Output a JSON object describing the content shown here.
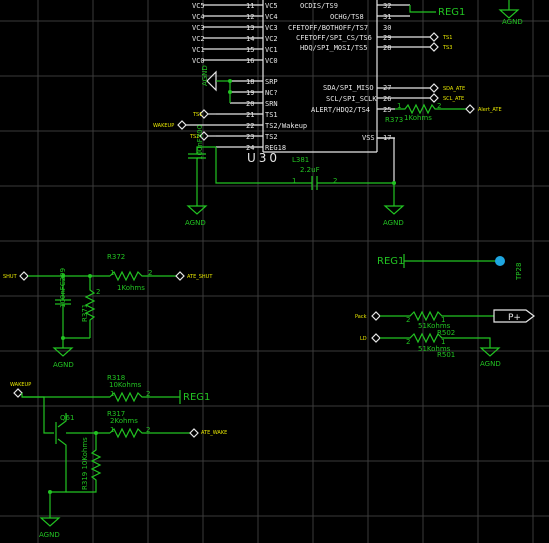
{
  "ic": {
    "refdes": "U30",
    "left": [
      {
        "net": "VC5",
        "num": "11",
        "pin": "VC5"
      },
      {
        "net": "VC4",
        "num": "12",
        "pin": "VC4"
      },
      {
        "net": "VC3",
        "num": "13",
        "pin": "VC3"
      },
      {
        "net": "VC2",
        "num": "14",
        "pin": "VC2"
      },
      {
        "net": "VC1",
        "num": "15",
        "pin": "VC1"
      },
      {
        "net": "VC0",
        "num": "16",
        "pin": "VC0"
      },
      {
        "num": "18",
        "pin": "SRP"
      },
      {
        "num": "19",
        "pin": "NC?"
      },
      {
        "num": "20",
        "pin": "SRN"
      },
      {
        "num": "21",
        "pin": "TS1"
      },
      {
        "num": "22",
        "pin": "TS2/Wakeup"
      },
      {
        "num": "23",
        "pin": "TS2"
      },
      {
        "num": "24",
        "pin": "REG18"
      }
    ],
    "right": [
      {
        "num": "32",
        "pin": "OCDIS/TS9"
      },
      {
        "num": "31",
        "pin": "OCHG/TS8"
      },
      {
        "num": "30",
        "pin": "CFETOFF/BOTHOFF/TS7"
      },
      {
        "num": "29",
        "pin": "CFETOFF/SPI_CS/TS6"
      },
      {
        "num": "28",
        "pin": "HDQ/SPI_MOSI/TS5"
      },
      {
        "num": "27",
        "pin": "SDA/SPI_MISO"
      },
      {
        "num": "26",
        "pin": "SCL/SPI_SCLK"
      },
      {
        "num": "25",
        "pin": "ALERT/HDQ2/TS4"
      },
      {
        "num": "17",
        "pin": "VSS"
      }
    ]
  },
  "nets": {
    "reg1": "REG1",
    "agnd": "AGND"
  },
  "ports": {
    "ts1": "TS1",
    "ts2": "TS2",
    "ts3": "TS3",
    "sda": "SDA_ATE",
    "scl": "SCL_ATE",
    "alert": "Alert_ATE",
    "wakeup": "WAKEUP",
    "shut": "SHUT",
    "ate_shut": "ATE_SHUT",
    "ate_wake": "ATE_WAKE",
    "pack": "Pack",
    "ld": "LD",
    "p_plus": "P+"
  },
  "components": {
    "r373": {
      "ref": "R373",
      "value": "1Kohms",
      "pin1": "1",
      "pin2": "2"
    },
    "c300": {
      "label": "100nF300"
    },
    "l381": {
      "ref": "L381",
      "value": "2.2uF",
      "pin1": "1",
      "pin2": "2"
    },
    "tp28": {
      "ref": "TP28"
    },
    "r372": {
      "ref": "R372",
      "value": "1Kohms",
      "pin1": "1",
      "pin2": "2"
    },
    "c299": {
      "label": "100nFC299"
    },
    "r371": {
      "ref": "R371",
      "pin2": "2"
    },
    "r318": {
      "ref": "R318",
      "value": "10Kohms",
      "pin1": "1",
      "pin2": "2"
    },
    "r317": {
      "ref": "R317",
      "value": "2Kohms",
      "pin1": "1",
      "pin2": "2"
    },
    "q61": {
      "ref": "Q61"
    },
    "r319": {
      "label": "R319 10Kohms"
    },
    "r502": {
      "ref": "R502",
      "value": "51Kohms",
      "pin1": "1",
      "pin2": "2"
    },
    "r501": {
      "ref": "R501",
      "value": "51Kohms",
      "pin1": "1",
      "pin2": "2"
    }
  }
}
